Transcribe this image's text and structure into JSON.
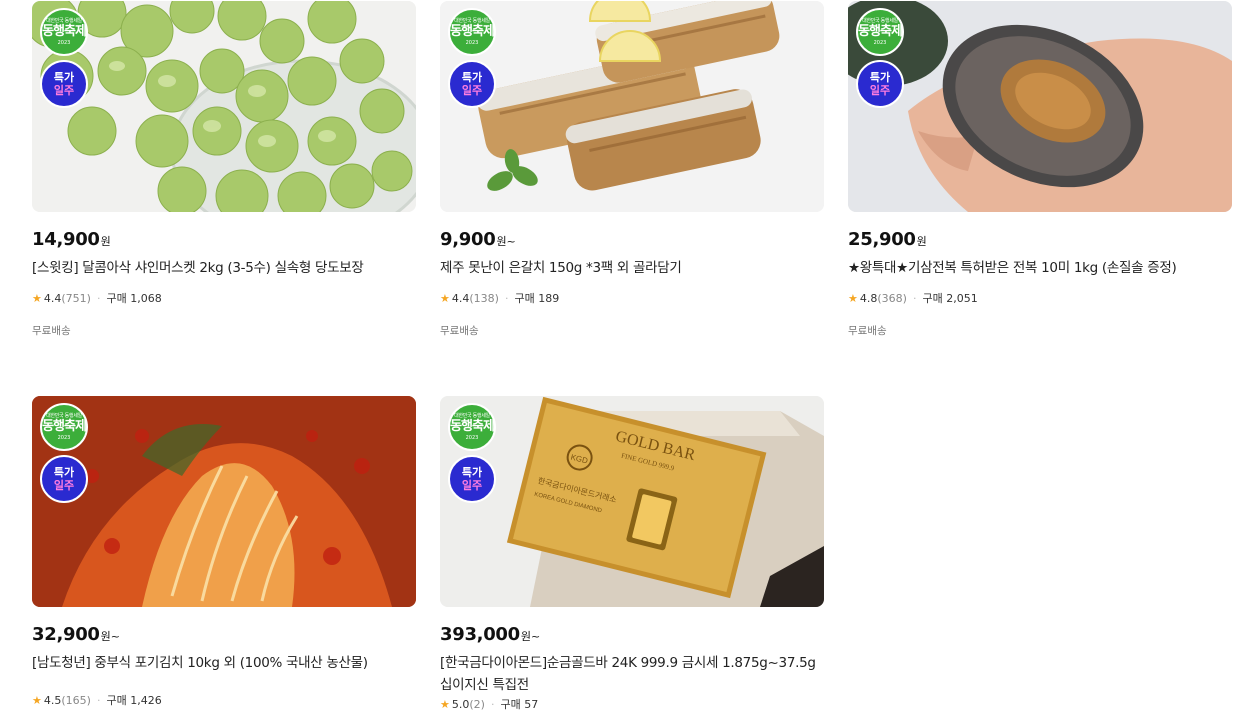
{
  "badges": {
    "festival_top": "대한민국 동행세일",
    "festival_main": "동행축제",
    "festival_year": "2023",
    "deal_line1": "특가",
    "deal_line2": "일주"
  },
  "products": [
    {
      "image_subject": "shine muscat grapes in glass bowl",
      "price": "14,900",
      "price_unit": "원",
      "title": "[스윗킹] 달콤아삭 샤인머스켓 2kg (3-5수) 실속형 당도보장",
      "rating": "4.4",
      "review_count": "(751)",
      "purchase_label": "구매",
      "purchase_count": "1,068",
      "shipping": "무료배송"
    },
    {
      "image_subject": "grilled hairtail fish with lemon",
      "price": "9,900",
      "price_unit": "원~",
      "title": "제주 못난이 은갈치 150g *3팩 외 골라담기",
      "rating": "4.4",
      "review_count": "(138)",
      "purchase_label": "구매",
      "purchase_count": "189",
      "shipping": "무료배송"
    },
    {
      "image_subject": "abalone held in hand",
      "price": "25,900",
      "price_unit": "원",
      "title": "★왕특대★기삼전복 특허받은 전복 10미 1kg (손질솔 증정)",
      "rating": "4.8",
      "review_count": "(368)",
      "purchase_label": "구매",
      "purchase_count": "2,051",
      "shipping": "무료배송"
    },
    {
      "image_subject": "napa cabbage kimchi",
      "price": "32,900",
      "price_unit": "원~",
      "title": "[남도청년] 중부식 포기김치 10kg 외 (100% 국내산 농산물)",
      "rating": "4.5",
      "review_count": "(165)",
      "purchase_label": "구매",
      "purchase_count": "1,426",
      "shipping": ""
    },
    {
      "image_subject": "gold bar in gift box",
      "price": "393,000",
      "price_unit": "원~",
      "title": "[한국금다이아몬드]순금골드바 24K 999.9 금시세 1.875g~37.5g 십이지신 특집전",
      "rating": "5.0",
      "review_count": "(2)",
      "purchase_label": "구매",
      "purchase_count": "57",
      "shipping": "",
      "gold_text": "GOLD BAR",
      "gold_sub": "FINE GOLD 999.9",
      "gold_brand": "한국금다이아몬드거래소",
      "gold_brand_en": "KOREA GOLD DIAMOND",
      "gold_logo": "KGD"
    }
  ],
  "colors": {
    "star": "#f5a623",
    "festival_badge": "#3cae3a",
    "deal_badge": "#2a2ad0",
    "deal_accent": "#ff7de0"
  }
}
